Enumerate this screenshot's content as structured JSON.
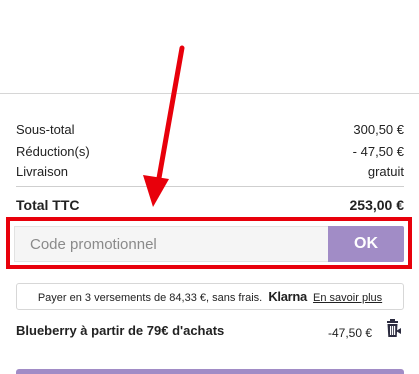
{
  "summary": {
    "subtotal_label": "Sous-total",
    "subtotal_value": "300,50 €",
    "discount_label": "Réduction(s)",
    "discount_value": "- 47,50 €",
    "shipping_label": "Livraison",
    "shipping_value": "gratuit",
    "total_label": "Total TTC",
    "total_value": "253,00 €"
  },
  "promo": {
    "placeholder": "Code promotionnel",
    "value": "",
    "submit_label": "OK"
  },
  "klarna": {
    "text": "Payer en 3 versements de 84,33 €, sans frais.",
    "logo_text": "Klarna",
    "link_label": "En savoir plus"
  },
  "offer": {
    "label": "Blueberry à partir de 79€ d'achats",
    "amount": "-47,50 €",
    "remove_icon": "trash-icon"
  },
  "colors": {
    "accent": "#a18cc6",
    "annotation": "#e8000b"
  }
}
